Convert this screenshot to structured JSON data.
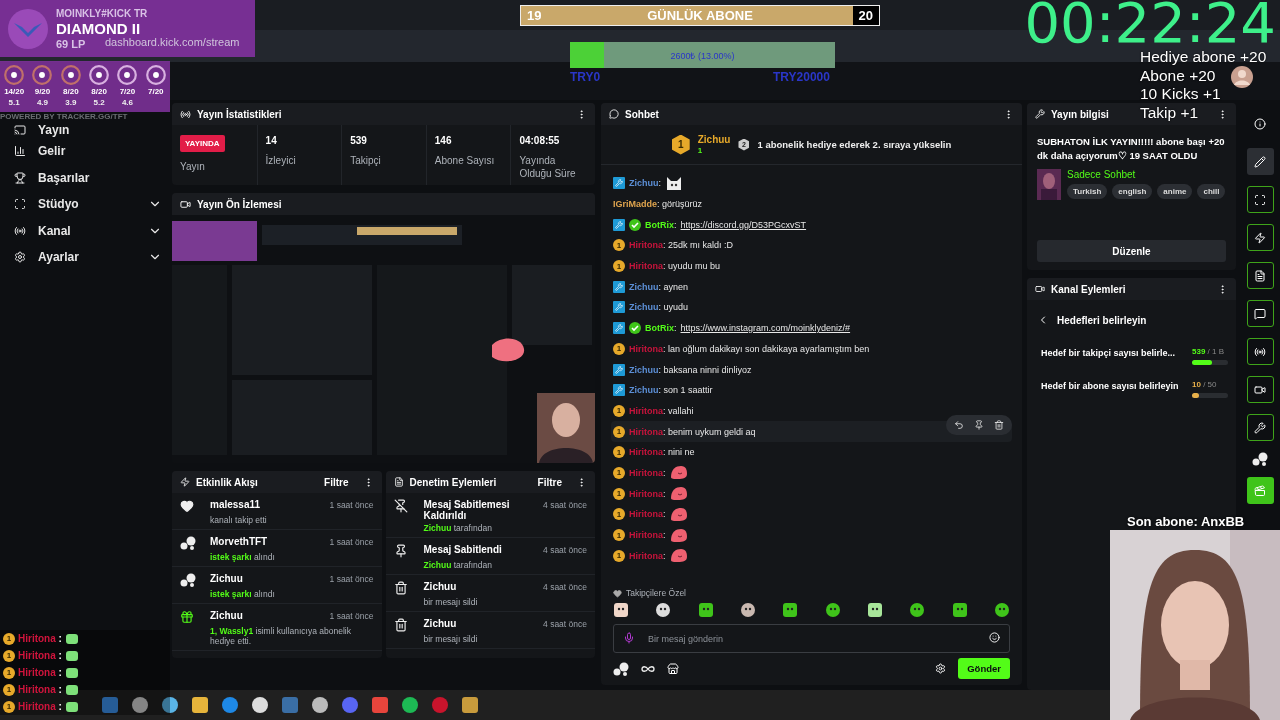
{
  "browser": {
    "url": "dashboard.kick.com/stream"
  },
  "rank_card": {
    "name": "MOINKLY#KICK TR",
    "rank": "DIAMOND II",
    "lp": "69 LP"
  },
  "tft_stats": [
    {
      "record": "14/20",
      "avg": "5.1"
    },
    {
      "record": "9/20",
      "avg": "4.9"
    },
    {
      "record": "8/20",
      "avg": "3.9"
    },
    {
      "record": "8/20",
      "avg": "5.2"
    },
    {
      "record": "7/20",
      "avg": "4.6"
    },
    {
      "record": "7/20"
    }
  ],
  "tracker_credit": "POWERED BY TRACKER.GG/TFT",
  "daily_sub_goal": {
    "title": "GÜNLÜK ABONE",
    "current": "19",
    "target": "20",
    "level": 0.93
  },
  "donation_goal": {
    "label": "2600₺ (13.00%)",
    "min": "TRY0",
    "max": "TRY20000",
    "level": 0.13
  },
  "timer": "00:22:24",
  "rewards": [
    "Hediye abone +20",
    "Abone +20",
    "10 Kicks +1",
    "Takip +1"
  ],
  "sidebar": {
    "items": [
      {
        "label": "Yayın",
        "expandable": false
      },
      {
        "label": "Gelir",
        "expandable": false
      },
      {
        "label": "Başarılar",
        "expandable": false
      },
      {
        "label": "Stüdyo",
        "expandable": true
      },
      {
        "label": "Kanal",
        "expandable": true
      },
      {
        "label": "Ayarlar",
        "expandable": true
      }
    ]
  },
  "stream_stats": {
    "title": "Yayın İstatistikleri",
    "status": "YAYINDA",
    "status_label": "Yayın",
    "stats": [
      {
        "value": "14",
        "label": "İzleyici"
      },
      {
        "value": "539",
        "label": "Takipçi"
      },
      {
        "value": "146",
        "label": "Abone Sayısı"
      },
      {
        "value": "04:08:55",
        "label": "Yayında Olduğu Süre"
      }
    ]
  },
  "preview": {
    "title": "Yayın Ön İzlemesi",
    "kind": "picture"
  },
  "activity_feed": {
    "title": "Etkinlik Akışı",
    "filter": "Filtre",
    "events": [
      {
        "kind": "follow",
        "name": "malessa11",
        "time": "1 saat önce",
        "text": "kanalı takip etti"
      },
      {
        "kind": "song",
        "name": "MorvethTFT",
        "time": "1 saat önce",
        "highlight": "istek şarkı",
        "text": "alındı"
      },
      {
        "kind": "song",
        "name": "Zichuu",
        "time": "1 saat önce",
        "highlight": "istek şarkı",
        "text": "alındı"
      },
      {
        "kind": "gift",
        "name": "Zichuu",
        "time": "1 saat önce",
        "highlight": "1, Wassly1",
        "text": "isimli kullanıcıya abonelik hediye etti."
      }
    ]
  },
  "moderation": {
    "title": "Denetim Eylemleri",
    "filter": "Filtre",
    "actions": [
      {
        "kind": "unpin",
        "title": "Mesaj Sabitlemesi Kaldırıldı",
        "time": "4 saat önce",
        "highlight": "Zichuu",
        "text": "tarafından"
      },
      {
        "kind": "pin",
        "title": "Mesaj Sabitlendi",
        "time": "4 saat önce",
        "highlight": "Zichuu",
        "text": "tarafından"
      },
      {
        "kind": "delete",
        "title": "Zichuu",
        "time": "4 saat önce",
        "text": "bir mesajı sildi"
      },
      {
        "kind": "delete",
        "title": "Zichuu",
        "time": "4 saat önce",
        "text": "bir mesajı sildi"
      }
    ]
  },
  "chat": {
    "title": "Sohbet",
    "pinned": {
      "rank": "1",
      "user": "Zichuu",
      "gifts": "1",
      "next_rank": "2",
      "text": "1 abonelik hediye ederek 2. sıraya yükselin"
    },
    "messages": [
      {
        "badge": {
          "kind": "mod"
        },
        "user": "Zichuu",
        "sep": ":",
        "color": "#5c8fd6",
        "kind": "emote",
        "emote": {
          "kind": "cat"
        }
      },
      {
        "user": "IGriMadde",
        "sep": ":",
        "color": "#e0a54e",
        "kind": "text",
        "text": "görüşürüz"
      },
      {
        "badge": {
          "kind": "mod"
        },
        "verified": true,
        "user": "BotRix",
        "sep": ":",
        "color": "#53fc18",
        "kind": "link",
        "text": "https://discord.gg/D53PGcxvST"
      },
      {
        "badge": {
          "kind": "sub",
          "label": "1"
        },
        "user": "Hiritona",
        "sep": ":",
        "color": "#c8143c",
        "kind": "text",
        "text": "25dk mı kaldı :D"
      },
      {
        "badge": {
          "kind": "sub",
          "label": "1"
        },
        "user": "Hiritona",
        "sep": ":",
        "color": "#c8143c",
        "kind": "text",
        "text": "uyudu mu bu"
      },
      {
        "badge": {
          "kind": "mod"
        },
        "user": "Zichuu",
        "sep": ":",
        "color": "#5c8fd6",
        "kind": "text",
        "text": "aynen"
      },
      {
        "badge": {
          "kind": "mod"
        },
        "user": "Zichuu",
        "sep": ":",
        "color": "#5c8fd6",
        "kind": "text",
        "text": "uyudu"
      },
      {
        "badge": {
          "kind": "mod"
        },
        "verified": true,
        "user": "BotRix",
        "sep": ":",
        "color": "#53fc18",
        "kind": "link",
        "text": "https://www.instagram.com/moinklydeniz/#"
      },
      {
        "badge": {
          "kind": "sub",
          "label": "1"
        },
        "user": "Hiritona",
        "sep": ":",
        "color": "#c8143c",
        "kind": "text",
        "text": "lan oğlum dakikayı son dakikaya ayarlamıştım ben"
      },
      {
        "badge": {
          "kind": "mod"
        },
        "user": "Zichuu",
        "sep": ":",
        "color": "#5c8fd6",
        "kind": "text",
        "text": "baksana ninni dinliyoz"
      },
      {
        "badge": {
          "kind": "mod"
        },
        "user": "Zichuu",
        "sep": ":",
        "color": "#5c8fd6",
        "kind": "text",
        "text": "son 1 saattir"
      },
      {
        "badge": {
          "kind": "sub",
          "label": "1"
        },
        "user": "Hiritona",
        "sep": ":",
        "color": "#c8143c",
        "kind": "text",
        "text": "vallahi"
      },
      {
        "badge": {
          "kind": "sub",
          "label": "1"
        },
        "user": "Hiritona",
        "sep": ":",
        "color": "#c8143c",
        "kind": "text",
        "text": "benim uykum geldi aq",
        "hovered": true
      },
      {
        "badge": {
          "kind": "sub",
          "label": "1"
        },
        "user": "Hiritona",
        "sep": ":",
        "color": "#c8143c",
        "kind": "text",
        "text": "nini ne"
      },
      {
        "badge": {
          "kind": "sub",
          "label": "1"
        },
        "user": "Hiritona",
        "sep": ":",
        "color": "#c8143c",
        "kind": "emote",
        "emote": {
          "kind": "blob"
        }
      },
      {
        "badge": {
          "kind": "sub",
          "label": "1"
        },
        "user": "Hiritona",
        "sep": ":",
        "color": "#c8143c",
        "kind": "emote",
        "emote": {
          "kind": "blob"
        }
      },
      {
        "badge": {
          "kind": "sub",
          "label": "1"
        },
        "user": "Hiritona",
        "sep": ":",
        "color": "#c8143c",
        "kind": "emote",
        "emote": {
          "kind": "blob"
        }
      },
      {
        "badge": {
          "kind": "sub",
          "label": "1"
        },
        "user": "Hiritona",
        "sep": ":",
        "color": "#c8143c",
        "kind": "emote",
        "emote": {
          "kind": "blob"
        }
      },
      {
        "badge": {
          "kind": "sub",
          "label": "1"
        },
        "user": "Hiritona",
        "sep": ":",
        "color": "#c8143c",
        "kind": "emote",
        "emote": {
          "kind": "blob"
        }
      }
    ],
    "emote_tray": "Takipçilere Özel",
    "input": {
      "placeholder": "Bir mesaj gönderin"
    },
    "send": "Gönder"
  },
  "stream_info": {
    "title": "Yayın bilgisi",
    "stream_title": "SUBHATON İLK YAYIN!!!!! abone başı +20 dk daha açıyorum♡ 19 SAAT OLDU",
    "category": "Sadece Sohbet",
    "tags": [
      "Turkish",
      "english",
      "anime",
      "chill"
    ],
    "edit": "Düzenle"
  },
  "channel_actions": {
    "title": "Kanal Eylemleri",
    "back": "Hedefleri belirleyin",
    "goals": [
      {
        "label": "Hedef bir takipçi sayısı belirle...",
        "current": "539",
        "target": "/ 1 B",
        "level": 0.55,
        "color": "#53fc18"
      },
      {
        "label": "Hedef bir abone sayısı belirleyin",
        "current": "10",
        "target": "/ 50",
        "level": 0.2,
        "color": "#e8b04a"
      }
    ]
  },
  "last_sub": "Son abone: AnxBB",
  "overlay_chat": [
    {
      "user": "Hiritona",
      "badge": "1",
      "sep": ":"
    },
    {
      "user": "Hiritona",
      "badge": "1",
      "sep": ":"
    },
    {
      "user": "Hiritona",
      "badge": "1",
      "sep": ":"
    },
    {
      "user": "Hiritona",
      "badge": "1",
      "sep": ":"
    },
    {
      "user": "Hiritona",
      "badge": "1",
      "sep": ":"
    }
  ]
}
